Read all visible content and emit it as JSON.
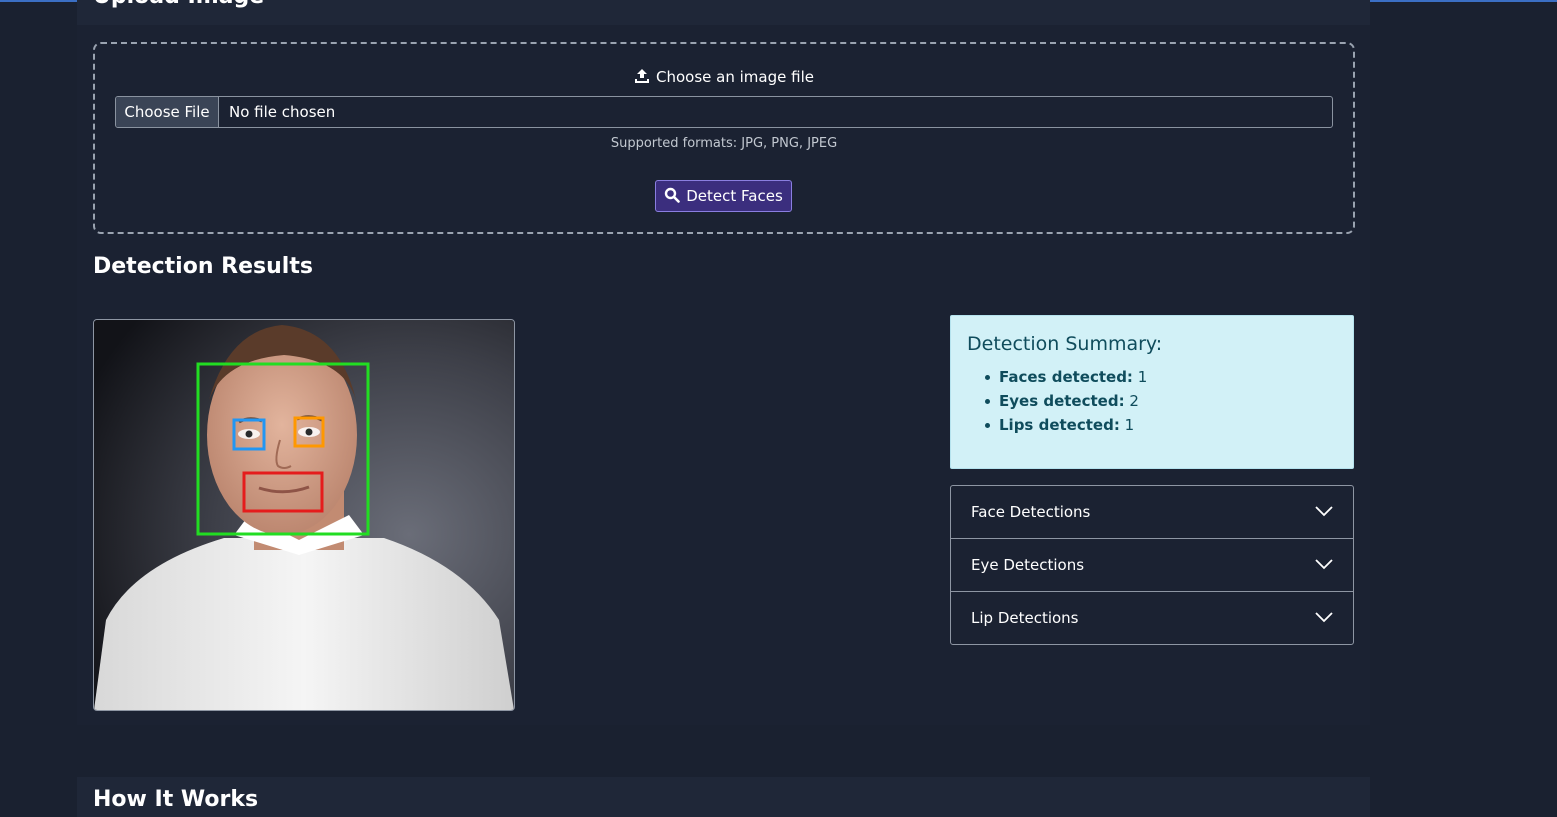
{
  "upload": {
    "section_title": "Upload Image",
    "prompt": "Choose an image file",
    "file_button": "Choose File",
    "file_status": "No file chosen",
    "supported_formats": "Supported formats: JPG, PNG, JPEG",
    "detect_button": "Detect Faces"
  },
  "results": {
    "title": "Detection Results",
    "summary": {
      "title": "Detection Summary:",
      "items": [
        {
          "label": "Faces detected:",
          "value": "1"
        },
        {
          "label": "Eyes detected:",
          "value": "2"
        },
        {
          "label": "Lips detected:",
          "value": "1"
        }
      ]
    },
    "accordion": [
      {
        "label": "Face Detections",
        "icon": "chevron-down-icon"
      },
      {
        "label": "Eye Detections",
        "icon": "chevron-down-icon"
      },
      {
        "label": "Lip Detections",
        "icon": "chevron-down-icon"
      }
    ],
    "box_colors": {
      "face": "#22dd22",
      "eye_left": "#2196f3",
      "eye_right": "#ff9800",
      "lips": "#e51c1c"
    }
  },
  "how_it_works": {
    "title": "How It Works"
  },
  "colors": {
    "background": "#1a2130",
    "summary_bg": "#d2f1f7",
    "summary_text": "#0f4c5c",
    "detect_button_bg": "#3b2e7e"
  }
}
